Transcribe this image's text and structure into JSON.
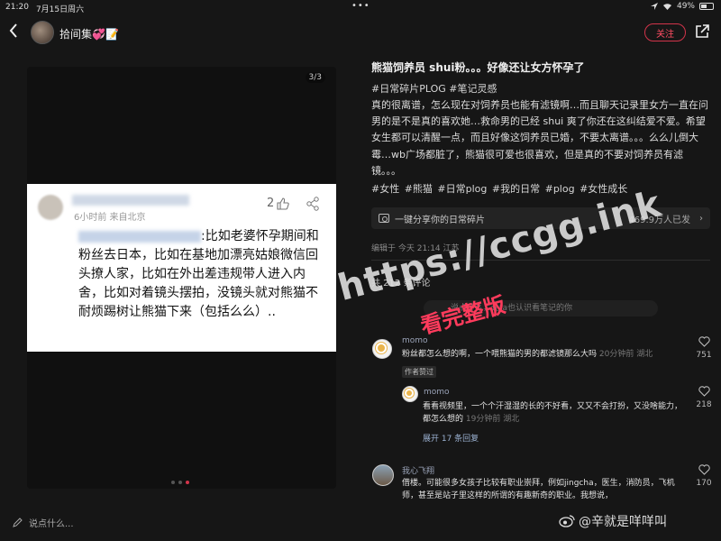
{
  "status_bar": {
    "time": "21:20",
    "date": "7月15日周六",
    "menu_dots": "•••",
    "battery": "49%",
    "battery_level": 0.49
  },
  "header": {
    "username": "拾间集💞📝",
    "follow_label": "关注"
  },
  "media": {
    "counter": "3/3",
    "card": {
      "meta": "6小时前  来自北京",
      "likes": "2",
      "text_after_mention": ":比如老婆怀孕期间和粉丝去日本，比如在基地加漂亮姑娘微信回头撩人家，比如在外出差违规带人进入内舍，比如对着镜头摆拍，没镜头就对熊猫不耐烦踢树让熊猫下来（包括么么）.."
    },
    "pager": {
      "total": 3,
      "active": 3
    }
  },
  "post": {
    "title": "熊猫饲养员 shui粉。。。好像还让女方怀孕了",
    "tags_top": "#日常碎片PLOG  #笔记灵感",
    "body": "真的很离谱，怎么现在对饲养员也能有滤镜啊…而且聊天记录里女方一直在问男的是不是真的喜欢她…救命男的已经 shui 爽了你还在这纠结爱不爱。希望女生都可以清醒一点，而且好像这饲养员已婚，不要太离谱。。。么么儿倒大霉…wb广场都脏了，熊猫很可爱也很喜欢，但是真的不要对饲养员有滤镜。。。",
    "tags_bottom": "#女性  #熊猫  #日常plog  #我的日常  #plog  #女性成长",
    "sync_label": "一键分享你的日常碎片",
    "sync_count": "469.9万人已发",
    "edit_meta": "编辑于 今天 21:14 江苏",
    "comment_count": "共 212 条评论",
    "comment_placeholder": "说点什么，让ta也认识看笔记的你"
  },
  "comments": [
    {
      "name": "momo",
      "text": "粉丝都怎么想的啊，一个喂熊猫的男的都滤镜那么大吗",
      "time": "20分钟前 湖北",
      "badge": "作者赞过",
      "likes": "751"
    },
    {
      "name": "momo",
      "text": "看看视频里，一个个汗湿湿的长的不好看，又又不会打扮，又没啥能力，都怎么想的",
      "time": "19分钟前 湖北",
      "likes": "218",
      "expand": "展开 17 条回复"
    },
    {
      "name": "我心飞翔",
      "text": "借楼。可能很多女孩子比较有职业崇拜，例如jingcha，医生，消防员，飞机师，甚至是站子里这样的所谓的有趣新奇的职业。我想说，",
      "likes": "170"
    }
  ],
  "bottom": {
    "input_label": "说点什么..."
  },
  "watermarks": {
    "url": "https://ccgg.ink",
    "subtitle": "看完整版",
    "weibo": "@辛就是咩咩叫"
  },
  "colors": {
    "accent": "#ff4d63",
    "background": "#161616"
  }
}
